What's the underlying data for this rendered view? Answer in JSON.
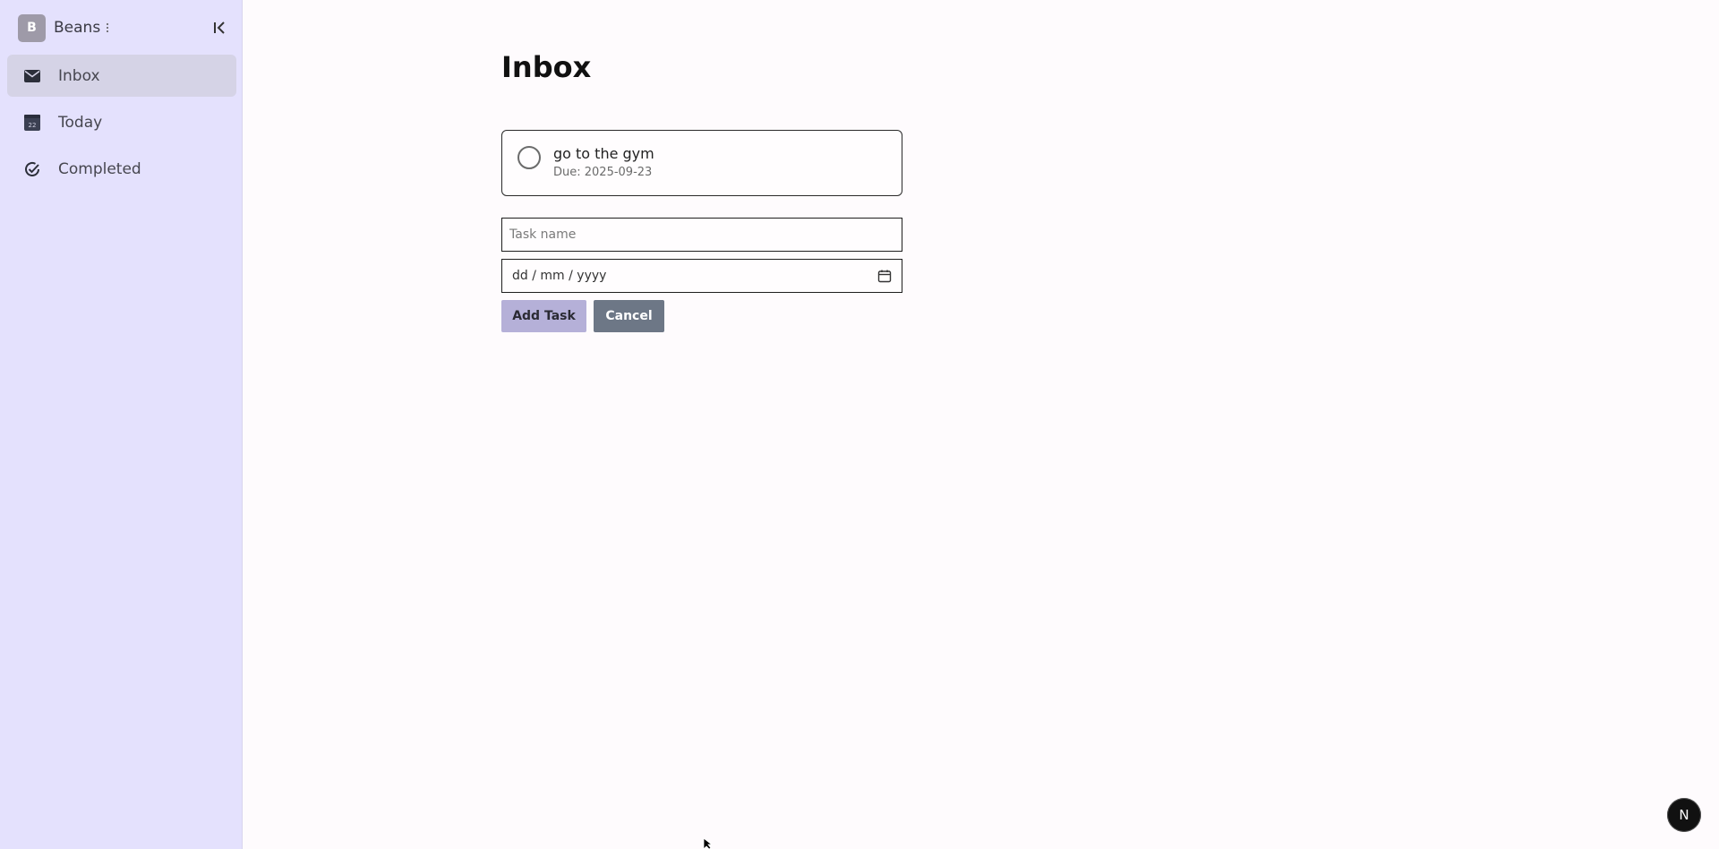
{
  "workspace": {
    "avatar_letter": "B",
    "name": "Beans"
  },
  "sidebar": {
    "items": [
      {
        "label": "Inbox",
        "icon": "mail-icon",
        "active": true
      },
      {
        "label": "Today",
        "icon": "calendar-today-icon",
        "active": false
      },
      {
        "label": "Completed",
        "icon": "check-circle-icon",
        "active": false
      }
    ]
  },
  "main": {
    "title": "Inbox",
    "tasks": [
      {
        "name": "go to the gym",
        "due": "Due: 2025-09-23"
      }
    ],
    "form": {
      "task_name_placeholder": "Task name",
      "date_placeholder": "dd / mm / yyyy",
      "add_label": "Add Task",
      "cancel_label": "Cancel"
    }
  },
  "fab": {
    "letter": "N"
  },
  "colors": {
    "sidebar_bg": "#e4e1fd",
    "active_item_bg": "#d5d3e6",
    "add_button_bg": "#b5b0d8",
    "cancel_button_bg": "#6d7786"
  }
}
